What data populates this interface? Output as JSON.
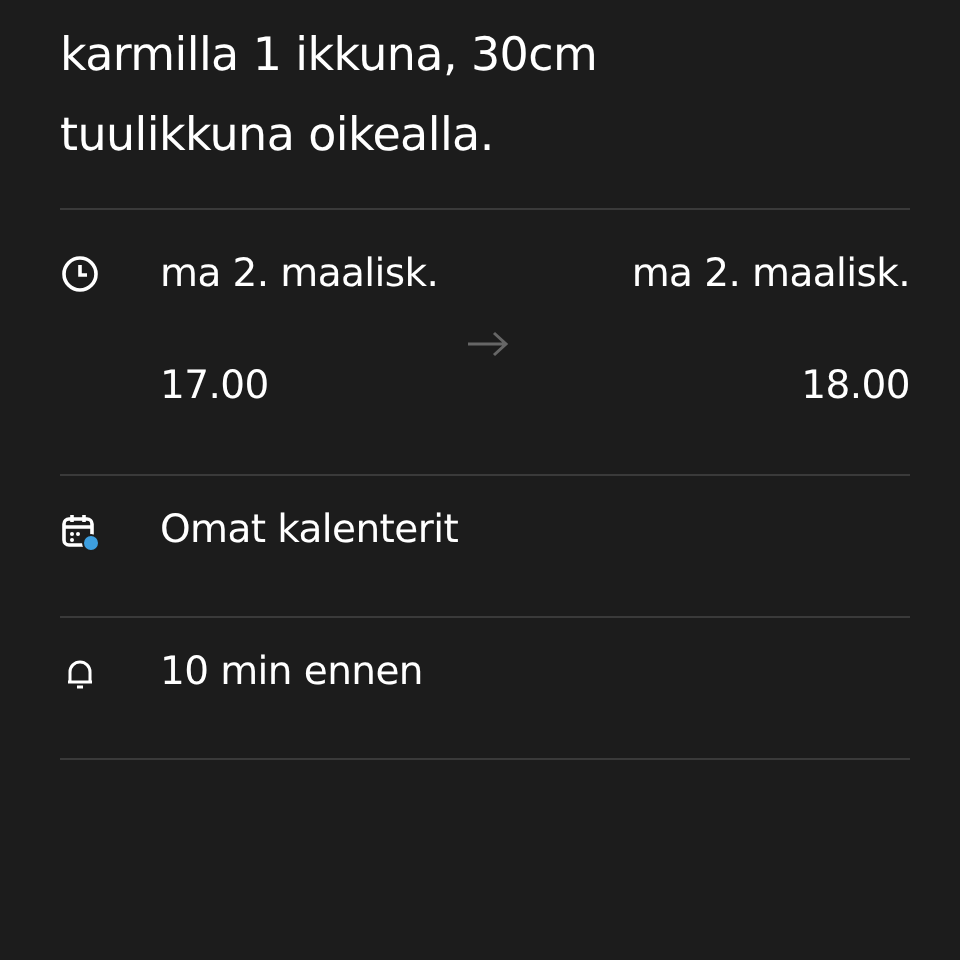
{
  "description": "karmilla 1 ikkuna, 30cm tuulikkuna oikealla.",
  "time": {
    "start_date": "ma 2. maalisk.",
    "start_time": "17.00",
    "end_date": "ma 2. maalisk.",
    "end_time": "18.00"
  },
  "calendar": {
    "name": "Omat kalenterit",
    "color": "#3d9fdf"
  },
  "reminder": "10 min ennen"
}
